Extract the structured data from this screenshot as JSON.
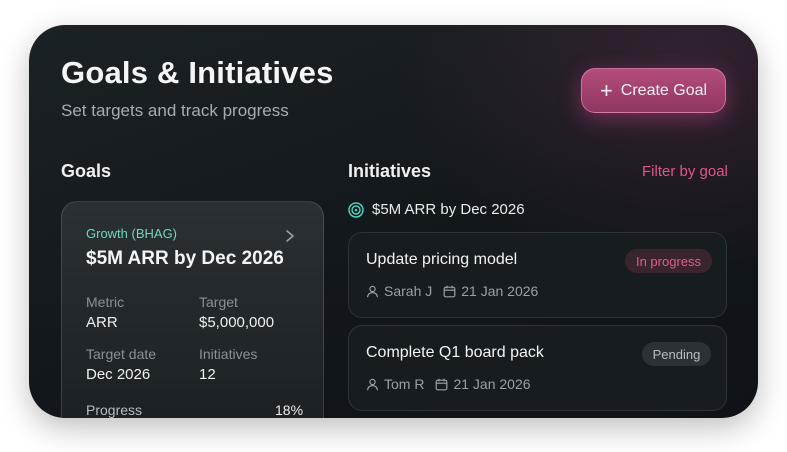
{
  "header": {
    "title": "Goals & Initiatives",
    "subtitle": "Set targets and track progress",
    "create_label": "Create Goal"
  },
  "goals": {
    "section_title": "Goals",
    "card": {
      "category": "Growth (BHAG)",
      "name": "$5M ARR by Dec 2026",
      "metric_label": "Metric",
      "metric_value": "ARR",
      "target_label": "Target",
      "target_value": "$5,000,000",
      "date_label": "Target date",
      "date_value": "Dec 2026",
      "initiatives_label": "Initiatives",
      "initiatives_value": "12",
      "progress_label": "Progress",
      "progress_value": "18%"
    }
  },
  "initiatives": {
    "section_title": "Initiatives",
    "filter_label": "Filter by goal",
    "selected_goal": "$5M ARR by Dec 2026",
    "items": [
      {
        "name": "Update pricing model",
        "owner": "Sarah J",
        "date": "21 Jan 2026",
        "status": "In progress"
      },
      {
        "name": "Complete Q1 board pack",
        "owner": "Tom R",
        "date": "21 Jan 2026",
        "status": "Pending"
      }
    ]
  },
  "colors": {
    "accent": "#e0568f",
    "kicker": "#6fd6c2",
    "panel_bg": "#12171b"
  },
  "icons": [
    "plus-icon",
    "chevron-right-icon",
    "target-icon",
    "user-icon",
    "calendar-icon"
  ]
}
